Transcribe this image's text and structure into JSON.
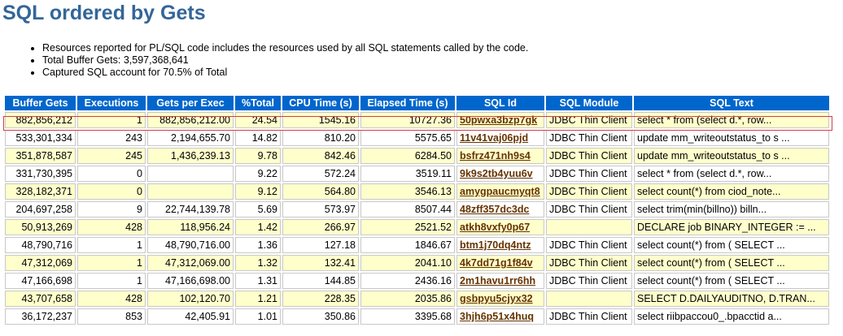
{
  "title": "SQL ordered by Gets",
  "notes": [
    "Resources reported for PL/SQL code includes the resources used by all SQL statements called by the code.",
    "Total Buffer Gets: 3,597,368,641",
    "Captured SQL account for 70.5% of Total"
  ],
  "table": {
    "headers": [
      "Buffer Gets",
      "Executions",
      "Gets per Exec",
      "%Total",
      "CPU Time (s)",
      "Elapsed Time (s)",
      "SQL Id",
      "SQL Module",
      "SQL Text"
    ],
    "rows": [
      [
        "882,856,212",
        "1",
        "882,856,212.00",
        "24.54",
        "1545.16",
        "10727.36",
        "50pwxa3bzp7gk",
        "JDBC Thin Client",
        "select * from (select d.*, row..."
      ],
      [
        "533,301,334",
        "243",
        "2,194,655.70",
        "14.82",
        "810.20",
        "5575.65",
        "11v41vaj06pjd",
        "JDBC Thin Client",
        "update mm_writeoutstatus_to s ..."
      ],
      [
        "351,878,587",
        "245",
        "1,436,239.13",
        "9.78",
        "842.46",
        "6284.50",
        "bsfrz471nh9s4",
        "JDBC Thin Client",
        "update mm_writeoutstatus_to s ..."
      ],
      [
        "331,730,395",
        "0",
        "",
        "9.22",
        "572.24",
        "3519.11",
        "9k9s2tb4yuu6v",
        "JDBC Thin Client",
        "select * from (select d.*, row..."
      ],
      [
        "328,182,371",
        "0",
        "",
        "9.12",
        "564.80",
        "3546.13",
        "amygpaucmyqt8",
        "JDBC Thin Client",
        "select count(*) from ciod_note..."
      ],
      [
        "204,697,258",
        "9",
        "22,744,139.78",
        "5.69",
        "573.97",
        "8507.44",
        "48zff357dc3dc",
        "JDBC Thin Client",
        "select trim(min(billno)) billn..."
      ],
      [
        "50,913,269",
        "428",
        "118,956.24",
        "1.42",
        "266.97",
        "2521.52",
        "atkh8vxfy0p67",
        "",
        "DECLARE job BINARY_INTEGER := ..."
      ],
      [
        "48,790,716",
        "1",
        "48,790,716.00",
        "1.36",
        "127.18",
        "1846.67",
        "btm1j70dq4ntz",
        "JDBC Thin Client",
        "select count(*) from ( SELECT ..."
      ],
      [
        "47,312,069",
        "1",
        "47,312,069.00",
        "1.32",
        "132.41",
        "2041.10",
        "4k7dd71g1f84v",
        "JDBC Thin Client",
        "select count(*) from ( SELECT ..."
      ],
      [
        "47,166,698",
        "1",
        "47,166,698.00",
        "1.31",
        "144.85",
        "2436.16",
        "2m1havu1rr6hh",
        "JDBC Thin Client",
        "select count(*) from ( SELECT ..."
      ],
      [
        "43,707,658",
        "428",
        "102,120.70",
        "1.21",
        "228.35",
        "2035.86",
        "gsbpyu5cjyx32",
        "",
        "SELECT D.DAILYAUDITNO, D.TRAN..."
      ],
      [
        "36,172,237",
        "853",
        "42,405.91",
        "1.01",
        "350.86",
        "3395.68",
        "3hjh6p51x4huq",
        "JDBC Thin Client",
        "select riibpaccou0_.bpacctid a..."
      ]
    ]
  },
  "colors": {
    "title": "#336699",
    "header_bg": "#0066cc",
    "row_odd_bg": "#ffffcc",
    "row_even_bg": "#ffffff",
    "sql_id_link": "#663300",
    "highlight_border": "#d04040"
  }
}
